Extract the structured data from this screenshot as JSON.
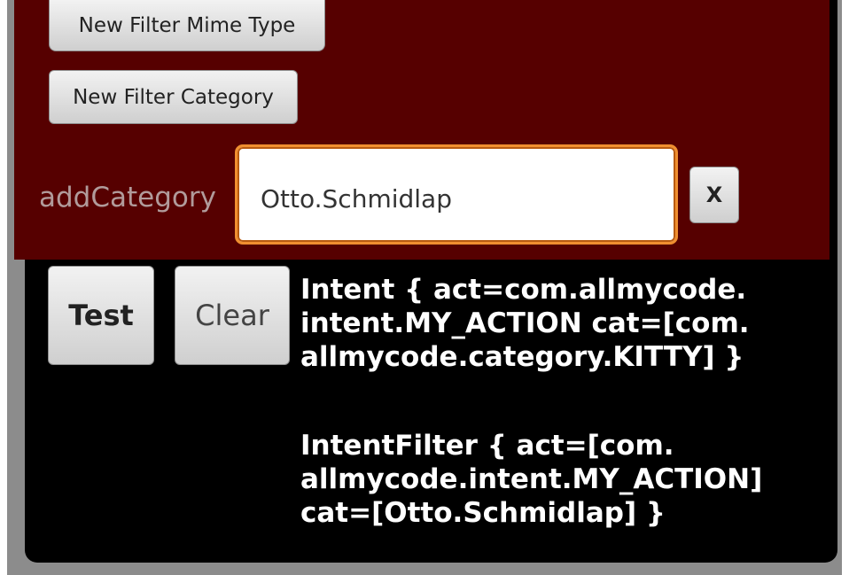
{
  "filter_panel": {
    "new_mime_label": "New Filter Mime Type",
    "new_category_label": "New Filter Category",
    "add_category_label": "addCategory",
    "category_value": "Otto.Schmidlap",
    "remove_label": "X"
  },
  "actions": {
    "test_label": "Test",
    "clear_label": "Clear"
  },
  "output": {
    "intent_text": "Intent { act=com.allmycode.\nintent.MY_ACTION cat=[com.\nallmycode.category.KITTY] }",
    "filter_text": "IntentFilter { act=[com.\nallmycode.intent.MY_ACTION]\ncat=[Otto.Schmidlap] }"
  },
  "colors": {
    "panel_bg": "#560000",
    "screen_bg": "#000000",
    "focus_border": "#f08f30",
    "label_text": "#b19b9b"
  }
}
